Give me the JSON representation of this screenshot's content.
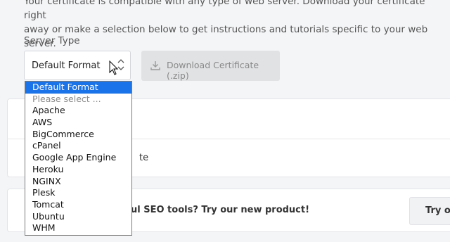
{
  "intro": {
    "line1": "Your certificate is compatible with any type of web server. Download your certificate right",
    "line2": "away or make a selection below to get instructions and tutorials specific to your web server."
  },
  "server_type": {
    "label": "Server Type",
    "selected": "Default Format",
    "options": [
      "Default Format",
      "Please select ...",
      "Apache",
      "AWS",
      "BigCommerce",
      "cPanel",
      "Google App Engine",
      "Heroku",
      "NGINX",
      "Plesk",
      "Tomcat",
      "Ubuntu",
      "WHM"
    ]
  },
  "download_button": {
    "label": "Download Certificate (.zip)",
    "icon": "download-icon"
  },
  "card1": {
    "text_fragment": "te"
  },
  "promo": {
    "text_fragment": "ul SEO tools? Try our new product!",
    "button_fragment": "Try ou"
  },
  "colors": {
    "selected_option": "#1a73e8",
    "disabled_button": "#e1e2e4"
  }
}
